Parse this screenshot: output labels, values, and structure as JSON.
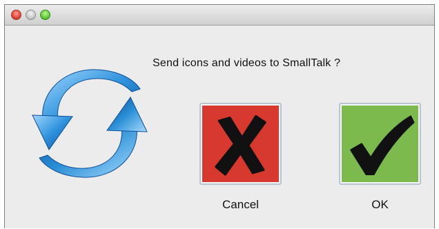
{
  "dialog": {
    "message": "Send icons and videos to SmallTalk ?",
    "cancel_label": "Cancel",
    "ok_label": "OK"
  },
  "icons": {
    "close": "close-traffic-light",
    "minimize": "minimize-traffic-light",
    "zoom": "zoom-traffic-light",
    "sync": "sync-arrows-icon",
    "cancel": "x-mark-icon",
    "ok": "checkmark-icon"
  },
  "colors": {
    "cancel_bg": "#d8392f",
    "ok_bg": "#7cba4e",
    "sync_blue": "#2a8fd6"
  }
}
